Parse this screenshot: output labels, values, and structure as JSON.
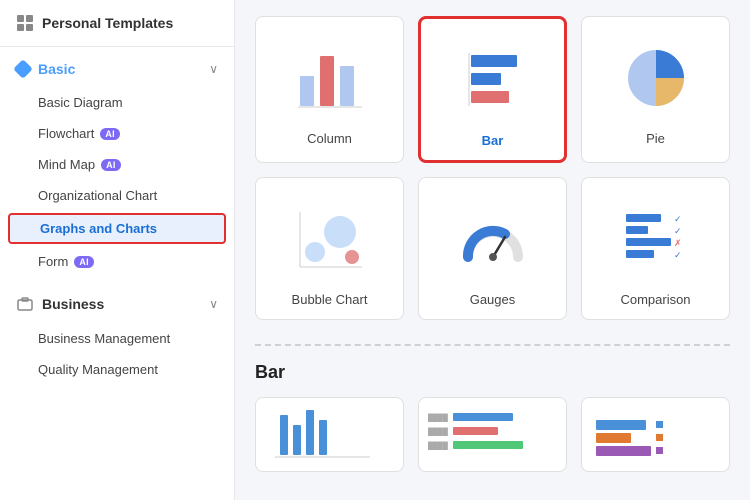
{
  "sidebar": {
    "header": {
      "title": "Personal Templates",
      "icon": "template-icon"
    },
    "groups": [
      {
        "id": "basic",
        "label": "Basic",
        "expanded": true,
        "items": [
          {
            "id": "basic-diagram",
            "label": "Basic Diagram",
            "ai": false,
            "active": false
          },
          {
            "id": "flowchart",
            "label": "Flowchart",
            "ai": true,
            "active": false
          },
          {
            "id": "mind-map",
            "label": "Mind Map",
            "ai": true,
            "active": false
          },
          {
            "id": "organizational-chart",
            "label": "Organizational Chart",
            "ai": false,
            "active": false
          },
          {
            "id": "graphs-and-charts",
            "label": "Graphs and Charts",
            "ai": false,
            "active": true
          },
          {
            "id": "form",
            "label": "Form",
            "ai": true,
            "active": false
          }
        ]
      },
      {
        "id": "business",
        "label": "Business",
        "expanded": true,
        "items": [
          {
            "id": "business-management",
            "label": "Business Management",
            "ai": false,
            "active": false
          },
          {
            "id": "quality-management",
            "label": "Quality Management",
            "ai": false,
            "active": false
          }
        ]
      }
    ]
  },
  "content": {
    "top_grid": [
      {
        "id": "column",
        "label": "Column",
        "selected": false
      },
      {
        "id": "bar",
        "label": "Bar",
        "selected": true
      },
      {
        "id": "pie",
        "label": "Pie",
        "selected": false
      },
      {
        "id": "bubble-chart",
        "label": "Bubble Chart",
        "selected": false
      },
      {
        "id": "gauges",
        "label": "Gauges",
        "selected": false
      },
      {
        "id": "comparison",
        "label": "Comparison",
        "selected": false
      }
    ],
    "section_label": "Bar",
    "bottom_cards": [
      {
        "id": "bar-1",
        "label": ""
      },
      {
        "id": "bar-2",
        "label": ""
      },
      {
        "id": "bar-3",
        "label": ""
      }
    ]
  },
  "badges": {
    "ai_label": "AI"
  }
}
